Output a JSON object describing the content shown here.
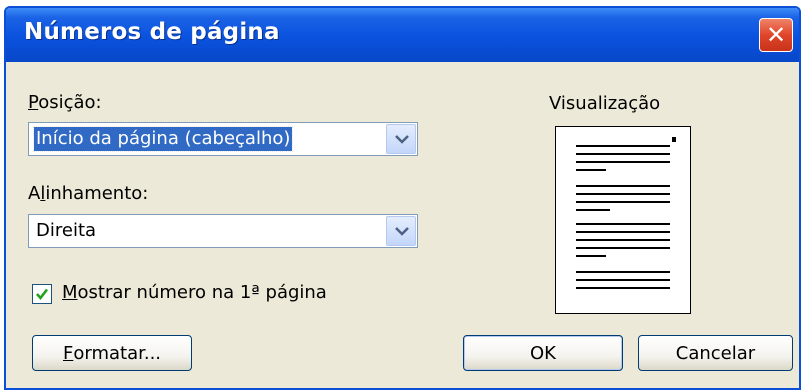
{
  "dialog": {
    "title": "Números de página",
    "close_glyph": "✕"
  },
  "position": {
    "label_prefix": "",
    "label_access": "P",
    "label_rest": "osição:",
    "value": "Início da página (cabeçalho)"
  },
  "alignment": {
    "label_prefix": "A",
    "label_access": "l",
    "label_rest": "inhamento:",
    "value": "Direita"
  },
  "first_page": {
    "label_access": "M",
    "label_rest": "ostrar número na 1ª página",
    "checked": true
  },
  "preview": {
    "label": "Visualização"
  },
  "buttons": {
    "format_access": "F",
    "format_rest": "ormatar...",
    "ok": "OK",
    "cancel": "Cancelar"
  },
  "icons": {
    "close": "close-icon",
    "dropdown": "chevron-down-icon",
    "check": "checkmark-icon"
  },
  "colors": {
    "title_bar": "#0a52de",
    "dialog_bg": "#ece9d8",
    "close_button": "#e0452a",
    "selection": "#316ac5"
  }
}
